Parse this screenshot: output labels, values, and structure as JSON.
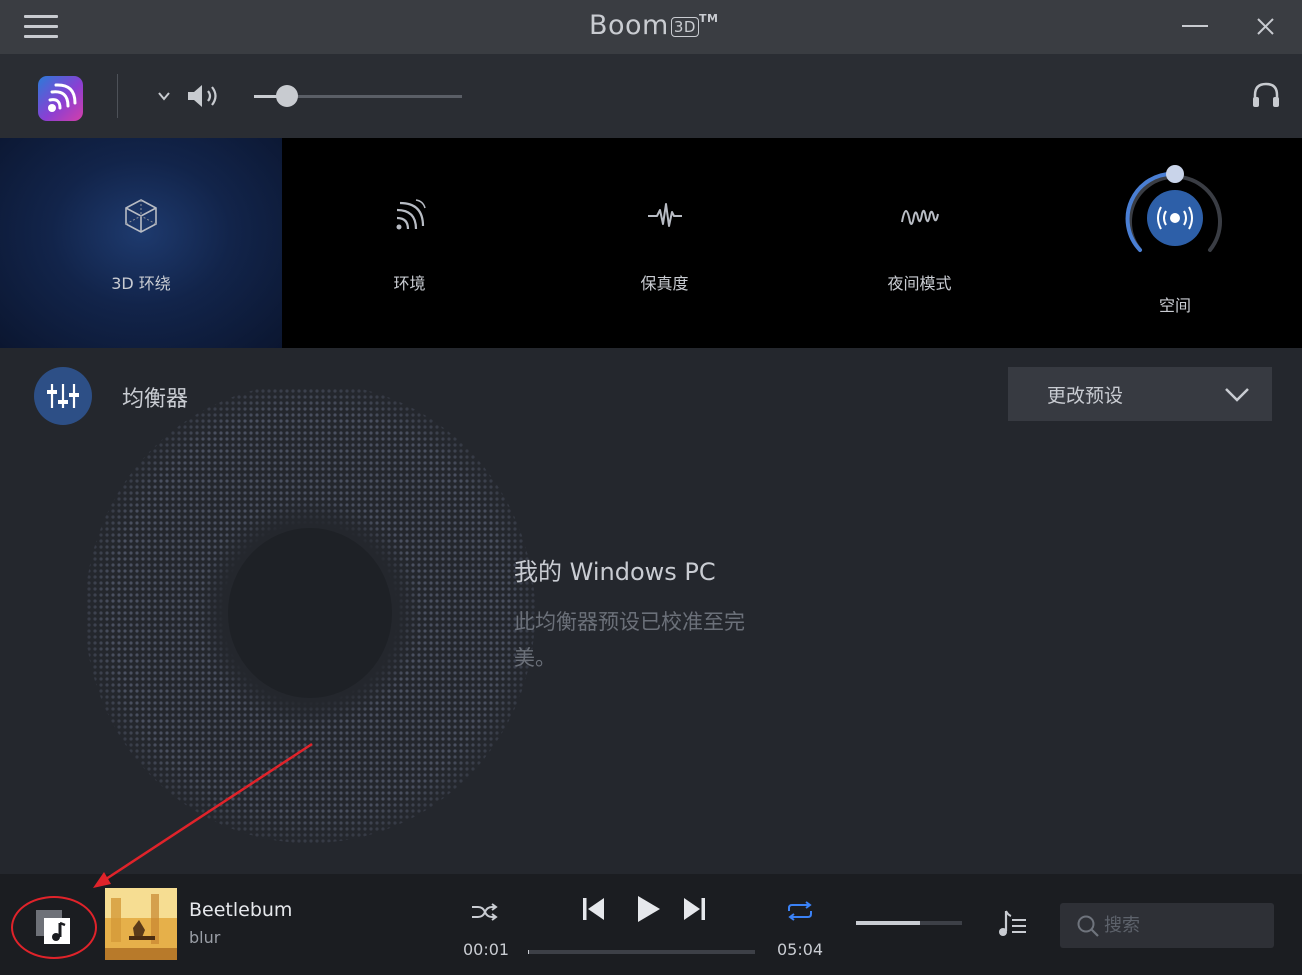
{
  "window": {
    "title": "Boom",
    "title_badge": "3D",
    "trademark": "TM"
  },
  "volume": {
    "level": 0.16
  },
  "effects": [
    {
      "label": "3D 环绕",
      "icon": "cube-icon",
      "active": true
    },
    {
      "label": "环境",
      "icon": "ambience-icon",
      "active": false
    },
    {
      "label": "保真度",
      "icon": "fidelity-icon",
      "active": false
    },
    {
      "label": "夜间模式",
      "icon": "night-mode-icon",
      "active": false
    },
    {
      "label": "空间",
      "icon": "spatial-icon",
      "active": false
    }
  ],
  "equalizer": {
    "title": "均衡器",
    "preset_dropdown": "更改预设",
    "preset_title": "我的 Windows PC",
    "preset_description": "此均衡器预设已校准至完美。"
  },
  "player": {
    "track_title": "Beetlebum",
    "track_artist": "blur",
    "elapsed": "00:01",
    "duration": "05:04",
    "progress": 0.003,
    "volume": 0.6,
    "search_placeholder": "搜索"
  },
  "colors": {
    "accent": "#2d4f86",
    "repeat_active": "#3b82f6",
    "annotation": "#e0232a"
  }
}
